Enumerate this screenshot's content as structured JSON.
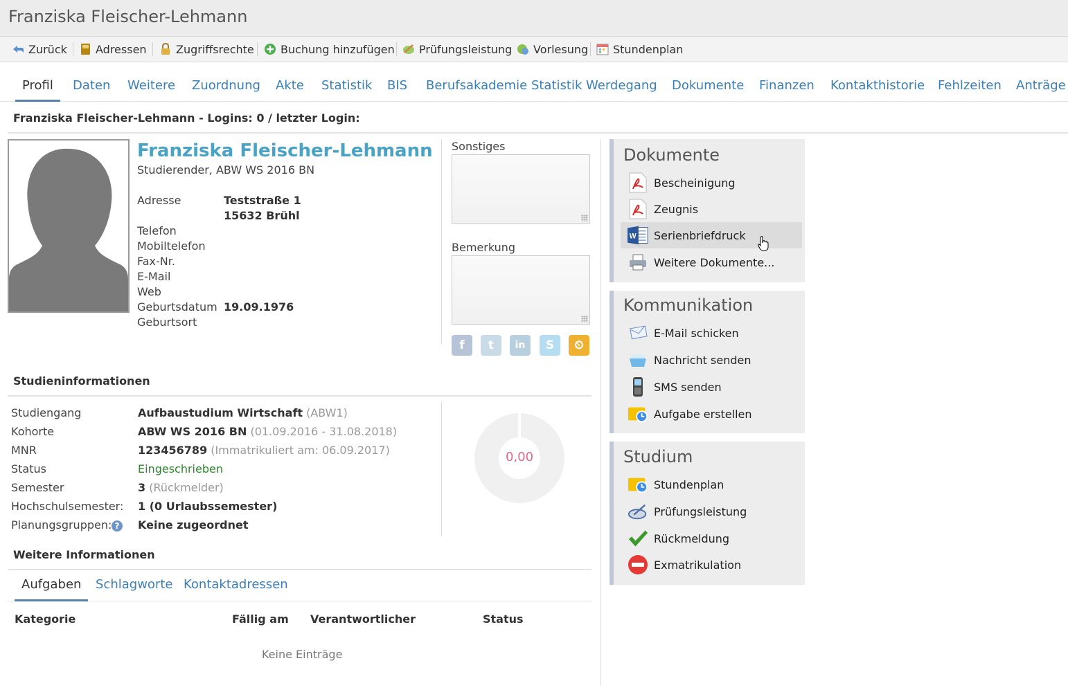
{
  "window": {
    "title": "Franziska Fleischer-Lehmann"
  },
  "toolbar": {
    "items": [
      {
        "label": "Zurück",
        "icon": "back-arrow-icon"
      },
      {
        "label": "Adressen",
        "icon": "address-book-icon"
      },
      {
        "label": "Zugriffsrechte",
        "icon": "lock-icon"
      },
      {
        "label": "Buchung hinzufügen",
        "icon": "add-circle-icon"
      },
      {
        "label": "Prüfungsleistung",
        "icon": "exam-icon"
      },
      {
        "label": "Vorlesung",
        "icon": "lecture-icon"
      },
      {
        "label": "Stundenplan",
        "icon": "calendar-icon"
      }
    ]
  },
  "tabs": [
    "Profil",
    "Daten",
    "Weitere",
    "Zuordnung",
    "Akte",
    "Statistik",
    "BIS",
    "Berufsakademie Statistik",
    "Werdegang",
    "Dokumente",
    "Finanzen",
    "Kontakthistorie",
    "Fehlzeiten",
    "Anträge"
  ],
  "active_tab": "Profil",
  "login_line": "Franziska Fleischer-Lehmann - Logins: 0 / letzter Login:",
  "profile": {
    "name": "Franziska Fleischer-Lehmann",
    "subtitle": "Studierender, ABW WS 2016 BN",
    "fields": {
      "adresse_label": "Adresse",
      "adresse_line1": "Teststraße 1",
      "adresse_line2": "15632 Brühl",
      "telefon_label": "Telefon",
      "mobil_label": "Mobiltelefon",
      "fax_label": "Fax-Nr.",
      "email_label": "E-Mail",
      "web_label": "Web",
      "geburtsdatum_label": "Geburtsdatum",
      "geburtsdatum_value": "19.09.1976",
      "geburtsort_label": "Geburtsort"
    }
  },
  "notes": {
    "sonstiges_label": "Sonstiges",
    "bemerkung_label": "Bemerkung"
  },
  "social": [
    "f",
    "t",
    "in",
    "S",
    "⏲"
  ],
  "studium_info": {
    "heading": "Studieninformationen",
    "studiengang_label": "Studiengang",
    "studiengang_value": "Aufbaustudium Wirtschaft",
    "studiengang_extra": "(ABW1)",
    "kohorte_label": "Kohorte",
    "kohorte_value": "ABW WS 2016 BN",
    "kohorte_extra": "(01.09.2016 - 31.08.2018)",
    "mnr_label": "MNR",
    "mnr_value": "123456789",
    "mnr_extra": "(Immatrikuliert am: 06.09.2017)",
    "status_label": "Status",
    "status_value": "Eingeschrieben",
    "semester_label": "Semester",
    "semester_value": "3",
    "semester_extra": "(Rückmelder)",
    "hochschulsemester_label": "Hochschulsemester:",
    "hochschulsemester_value": "1 (0 Urlaubssemester)",
    "planungsgruppen_label": "Planungsgruppen:",
    "planungsgruppen_value": "Keine zugeordnet",
    "donut_value": "0,00",
    "status_color": "#2a8a2a"
  },
  "weitere": {
    "heading": "Weitere Informationen",
    "subtabs": [
      "Aufgaben",
      "Schlagworte",
      "Kontaktadressen"
    ],
    "columns": [
      "Kategorie",
      "Fällig am",
      "Verantwortlicher",
      "Status"
    ],
    "empty": "Keine Einträge"
  },
  "panels": {
    "dokumente": {
      "title": "Dokumente",
      "items": [
        "Bescheinigung",
        "Zeugnis",
        "Serienbriefdruck",
        "Weitere Dokumente..."
      ]
    },
    "kommunikation": {
      "title": "Kommunikation",
      "items": [
        "E-Mail schicken",
        "Nachricht senden",
        "SMS senden",
        "Aufgabe erstellen"
      ]
    },
    "studium": {
      "title": "Studium",
      "items": [
        "Stundenplan",
        "Prüfungsleistung",
        "Rückmeldung",
        "Exmatrikulation"
      ]
    }
  },
  "colors": {
    "link": "#3b7fb6",
    "name": "#4aa3c4",
    "accent": "#5580a8",
    "donut_text": "#e06a8b"
  }
}
